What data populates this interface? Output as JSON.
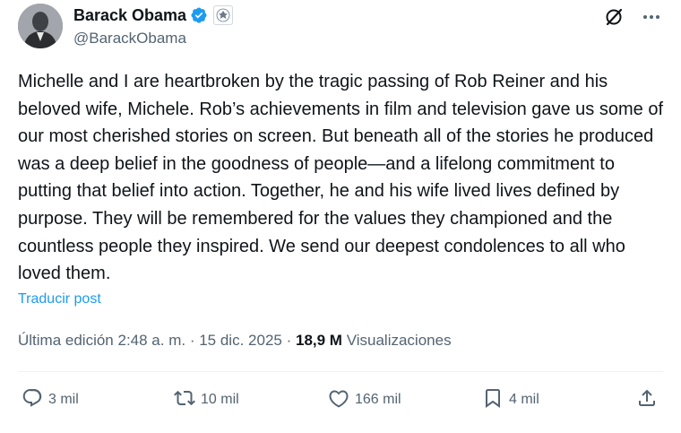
{
  "author": {
    "name": "Barack Obama",
    "handle": "@BarackObama",
    "verified_color": "#1d9bf0"
  },
  "tweet": {
    "text": "Michelle and I are heartbroken by the tragic passing of Rob Reiner and his beloved wife, Michele. Rob’s achievements in film and television gave us some of our most cherished stories on screen. But beneath all of the stories he produced was a deep belief in the goodness of people—and a lifelong commitment to putting that belief into action. Together, he and his wife lived lives defined by purpose. They will be remembered for the values they championed and the countless people they inspired. We send our deepest condolences to all who loved them.",
    "translate_label": "Traducir post",
    "edited_label": "Última edición 2:48 a. m.",
    "date": "15 dic. 2025",
    "views_count": "18,9 M",
    "views_label": "Visualizaciones"
  },
  "actions": {
    "replies": "3 mil",
    "reposts": "10 mil",
    "likes": "166 mil",
    "bookmarks": "4 mil"
  },
  "icons": {
    "top": [
      "grok-icon",
      "more-icon"
    ],
    "actions": [
      "reply-icon",
      "repost-icon",
      "like-icon",
      "bookmark-icon",
      "share-icon"
    ]
  },
  "colors": {
    "text": "#0f1419",
    "secondary": "#536471",
    "accent": "#1d9bf0",
    "divider": "#eff3f4"
  }
}
